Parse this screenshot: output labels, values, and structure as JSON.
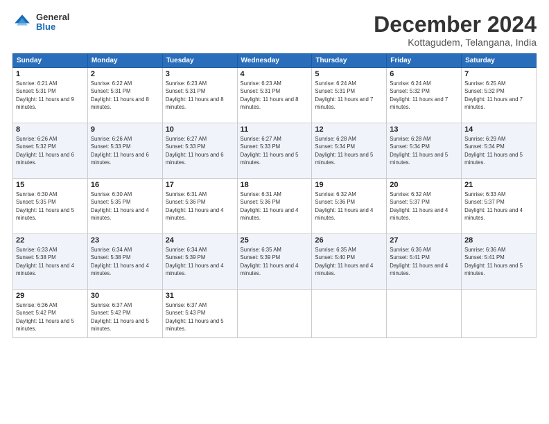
{
  "logo": {
    "general": "General",
    "blue": "Blue"
  },
  "header": {
    "month": "December 2024",
    "location": "Kottagudem, Telangana, India"
  },
  "weekdays": [
    "Sunday",
    "Monday",
    "Tuesday",
    "Wednesday",
    "Thursday",
    "Friday",
    "Saturday"
  ],
  "weeks": [
    [
      {
        "day": 1,
        "sunrise": "6:21 AM",
        "sunset": "5:31 PM",
        "daylight": "11 hours and 9 minutes."
      },
      {
        "day": 2,
        "sunrise": "6:22 AM",
        "sunset": "5:31 PM",
        "daylight": "11 hours and 8 minutes."
      },
      {
        "day": 3,
        "sunrise": "6:23 AM",
        "sunset": "5:31 PM",
        "daylight": "11 hours and 8 minutes."
      },
      {
        "day": 4,
        "sunrise": "6:23 AM",
        "sunset": "5:31 PM",
        "daylight": "11 hours and 8 minutes."
      },
      {
        "day": 5,
        "sunrise": "6:24 AM",
        "sunset": "5:31 PM",
        "daylight": "11 hours and 7 minutes."
      },
      {
        "day": 6,
        "sunrise": "6:24 AM",
        "sunset": "5:32 PM",
        "daylight": "11 hours and 7 minutes."
      },
      {
        "day": 7,
        "sunrise": "6:25 AM",
        "sunset": "5:32 PM",
        "daylight": "11 hours and 7 minutes."
      }
    ],
    [
      {
        "day": 8,
        "sunrise": "6:26 AM",
        "sunset": "5:32 PM",
        "daylight": "11 hours and 6 minutes."
      },
      {
        "day": 9,
        "sunrise": "6:26 AM",
        "sunset": "5:33 PM",
        "daylight": "11 hours and 6 minutes."
      },
      {
        "day": 10,
        "sunrise": "6:27 AM",
        "sunset": "5:33 PM",
        "daylight": "11 hours and 6 minutes."
      },
      {
        "day": 11,
        "sunrise": "6:27 AM",
        "sunset": "5:33 PM",
        "daylight": "11 hours and 5 minutes."
      },
      {
        "day": 12,
        "sunrise": "6:28 AM",
        "sunset": "5:34 PM",
        "daylight": "11 hours and 5 minutes."
      },
      {
        "day": 13,
        "sunrise": "6:28 AM",
        "sunset": "5:34 PM",
        "daylight": "11 hours and 5 minutes."
      },
      {
        "day": 14,
        "sunrise": "6:29 AM",
        "sunset": "5:34 PM",
        "daylight": "11 hours and 5 minutes."
      }
    ],
    [
      {
        "day": 15,
        "sunrise": "6:30 AM",
        "sunset": "5:35 PM",
        "daylight": "11 hours and 5 minutes."
      },
      {
        "day": 16,
        "sunrise": "6:30 AM",
        "sunset": "5:35 PM",
        "daylight": "11 hours and 4 minutes."
      },
      {
        "day": 17,
        "sunrise": "6:31 AM",
        "sunset": "5:36 PM",
        "daylight": "11 hours and 4 minutes."
      },
      {
        "day": 18,
        "sunrise": "6:31 AM",
        "sunset": "5:36 PM",
        "daylight": "11 hours and 4 minutes."
      },
      {
        "day": 19,
        "sunrise": "6:32 AM",
        "sunset": "5:36 PM",
        "daylight": "11 hours and 4 minutes."
      },
      {
        "day": 20,
        "sunrise": "6:32 AM",
        "sunset": "5:37 PM",
        "daylight": "11 hours and 4 minutes."
      },
      {
        "day": 21,
        "sunrise": "6:33 AM",
        "sunset": "5:37 PM",
        "daylight": "11 hours and 4 minutes."
      }
    ],
    [
      {
        "day": 22,
        "sunrise": "6:33 AM",
        "sunset": "5:38 PM",
        "daylight": "11 hours and 4 minutes."
      },
      {
        "day": 23,
        "sunrise": "6:34 AM",
        "sunset": "5:38 PM",
        "daylight": "11 hours and 4 minutes."
      },
      {
        "day": 24,
        "sunrise": "6:34 AM",
        "sunset": "5:39 PM",
        "daylight": "11 hours and 4 minutes."
      },
      {
        "day": 25,
        "sunrise": "6:35 AM",
        "sunset": "5:39 PM",
        "daylight": "11 hours and 4 minutes."
      },
      {
        "day": 26,
        "sunrise": "6:35 AM",
        "sunset": "5:40 PM",
        "daylight": "11 hours and 4 minutes."
      },
      {
        "day": 27,
        "sunrise": "6:36 AM",
        "sunset": "5:41 PM",
        "daylight": "11 hours and 4 minutes."
      },
      {
        "day": 28,
        "sunrise": "6:36 AM",
        "sunset": "5:41 PM",
        "daylight": "11 hours and 5 minutes."
      }
    ],
    [
      {
        "day": 29,
        "sunrise": "6:36 AM",
        "sunset": "5:42 PM",
        "daylight": "11 hours and 5 minutes."
      },
      {
        "day": 30,
        "sunrise": "6:37 AM",
        "sunset": "5:42 PM",
        "daylight": "11 hours and 5 minutes."
      },
      {
        "day": 31,
        "sunrise": "6:37 AM",
        "sunset": "5:43 PM",
        "daylight": "11 hours and 5 minutes."
      },
      null,
      null,
      null,
      null
    ]
  ]
}
